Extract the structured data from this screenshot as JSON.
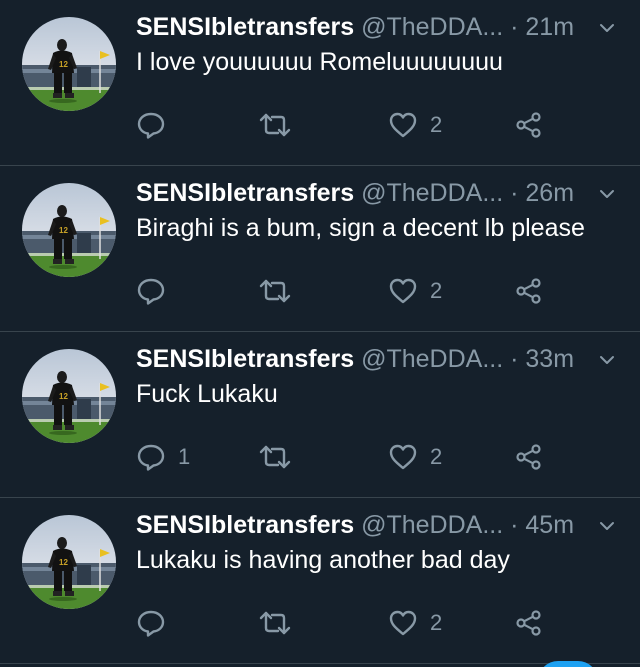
{
  "colors": {
    "background": "#15202b",
    "divider": "#38444d",
    "secondary_text": "#8899a6",
    "primary_text": "#ffffff",
    "accent": "#1da1f2"
  },
  "icons": {
    "reply": "reply-icon",
    "retweet": "retweet-icon",
    "like": "heart-icon",
    "share": "share-icon",
    "caret": "chevron-down-icon"
  },
  "tweets": [
    {
      "name": "SENSIbletransfers",
      "handle": "@TheDDA...",
      "separator": "·",
      "time": "21m",
      "text": "I love youuuuuu Romeluuuuuuuu",
      "replies": "",
      "retweets": "",
      "likes": "2"
    },
    {
      "name": "SENSIbletransfers",
      "handle": "@TheDDA...",
      "separator": "·",
      "time": "26m",
      "text": "Biraghi is a bum, sign a decent lb please",
      "replies": "",
      "retweets": "",
      "likes": "2"
    },
    {
      "name": "SENSIbletransfers",
      "handle": "@TheDDA...",
      "separator": "·",
      "time": "33m",
      "text": "Fuck Lukaku",
      "replies": "1",
      "retweets": "",
      "likes": "2"
    },
    {
      "name": "SENSIbletransfers",
      "handle": "@TheDDA...",
      "separator": "·",
      "time": "45m",
      "text": "Lukaku is having another bad day",
      "replies": "",
      "retweets": "",
      "likes": "2"
    }
  ]
}
